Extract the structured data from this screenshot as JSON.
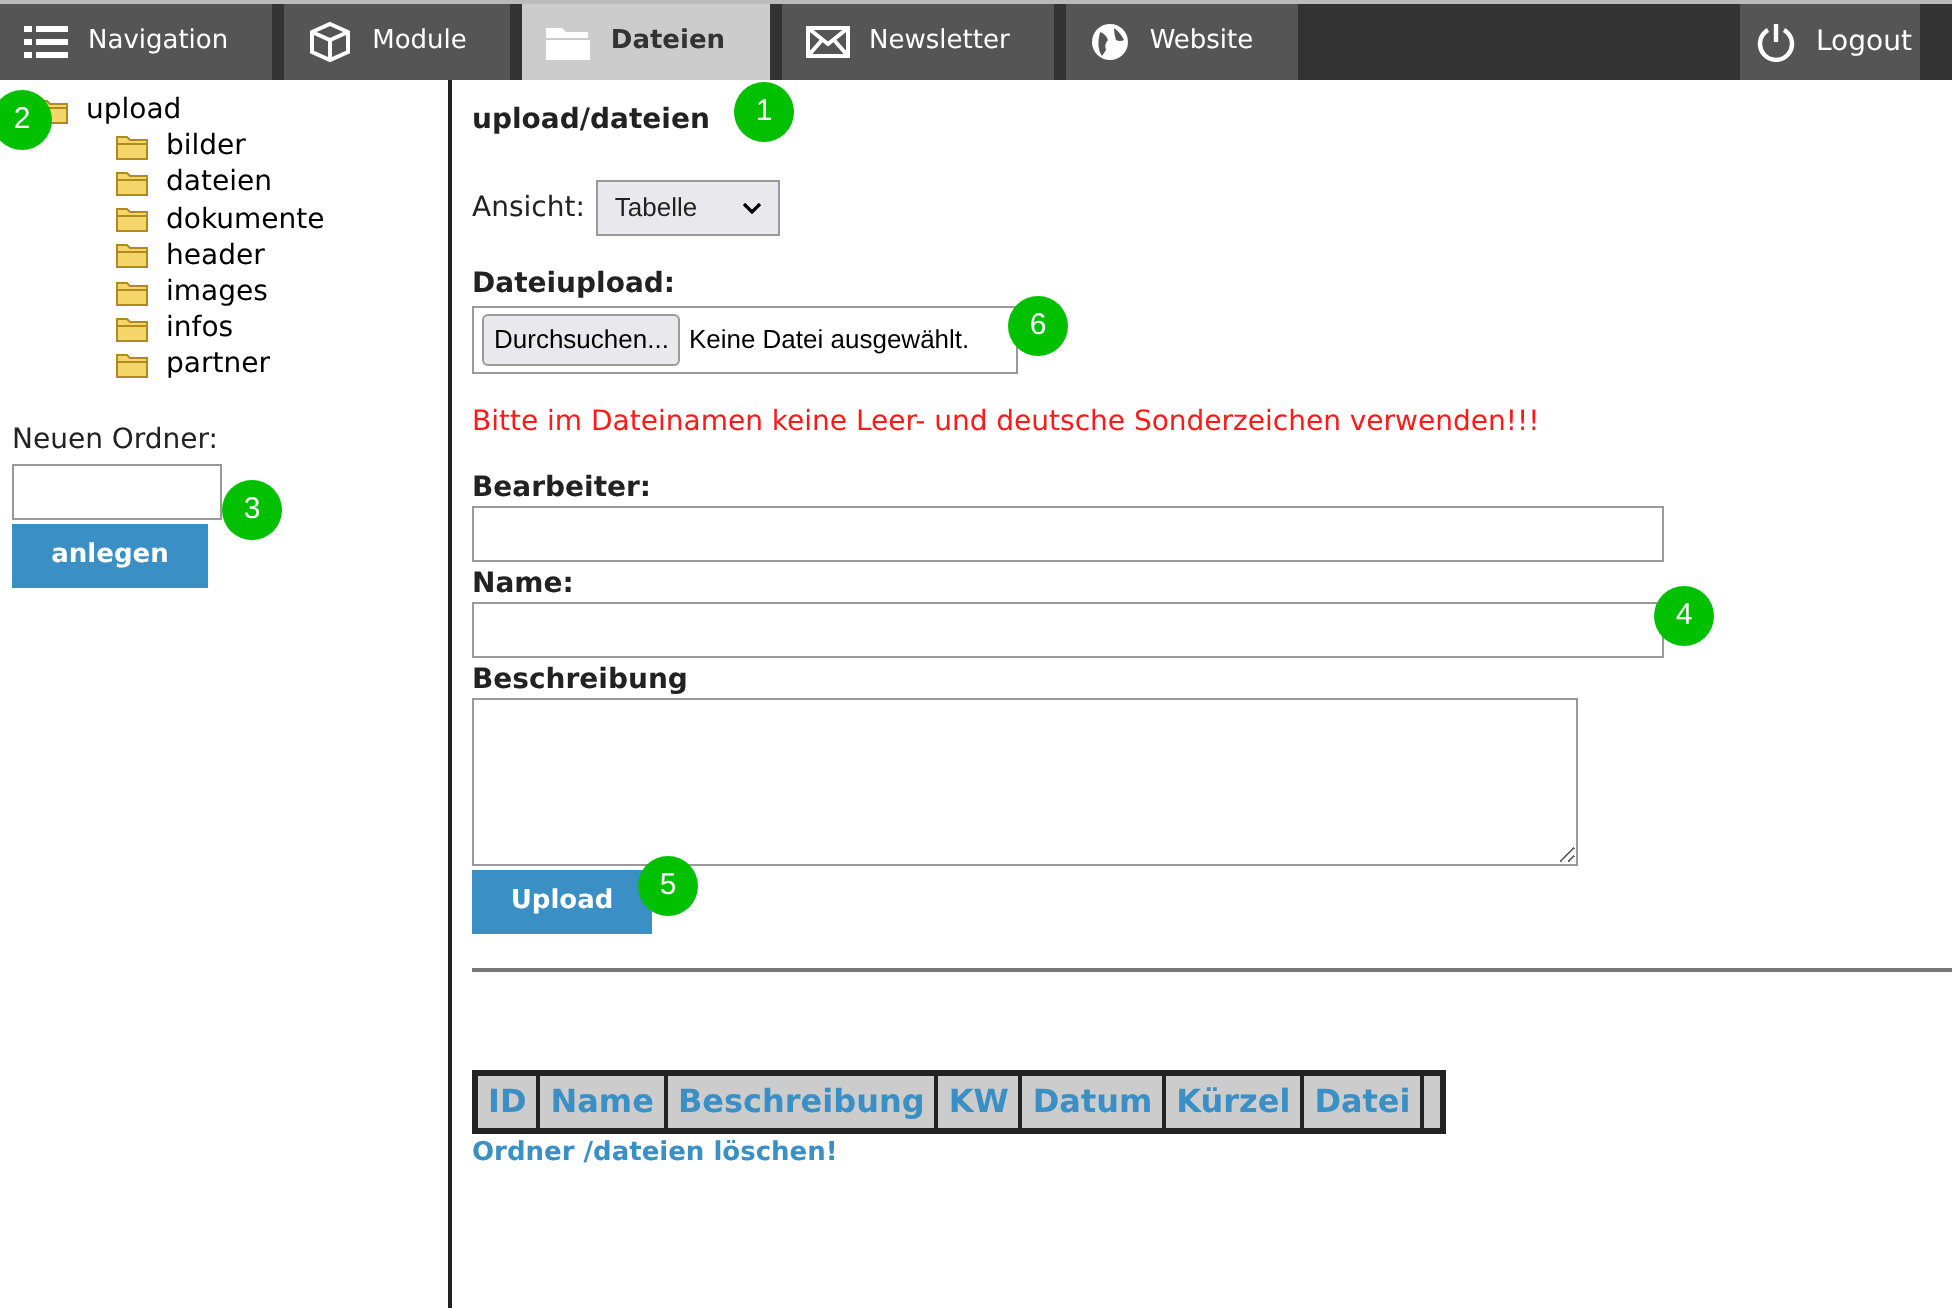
{
  "tabs": [
    {
      "label": "Navigation",
      "selected": false
    },
    {
      "label": "Module",
      "selected": false
    },
    {
      "label": "Dateien",
      "selected": true
    },
    {
      "label": "Newsletter",
      "selected": false
    },
    {
      "label": "Website",
      "selected": false
    }
  ],
  "logout": {
    "label": "Logout"
  },
  "folder_tree": [
    {
      "label": "upload",
      "children": [
        {
          "label": "bilder"
        },
        {
          "label": "dateien"
        },
        {
          "label": "dokumente"
        },
        {
          "label": "header"
        },
        {
          "label": "images"
        },
        {
          "label": "infos"
        },
        {
          "label": "partner"
        }
      ]
    }
  ],
  "new_folder": {
    "label": "Neuen Ordner:",
    "button": "anlegen"
  },
  "path": "upload/dateien",
  "view": {
    "label": "Ansicht:",
    "value": "Tabelle"
  },
  "upload": {
    "label": "Dateiupload:",
    "browse": "Durchsuchen...",
    "status": "Keine Datei ausgewählt."
  },
  "warning": "Bitte im Dateinamen keine Leer- und deutsche Sonderzeichen verwenden!!!",
  "fields": [
    {
      "label": "Bearbeiter:",
      "kind": "input"
    },
    {
      "label": "Name:",
      "kind": "input"
    },
    {
      "label": "Beschreibung",
      "kind": "textarea"
    }
  ],
  "submit": "Upload",
  "table": {
    "columns": [
      "ID",
      "Name",
      "Beschreibung",
      "KW",
      "Datum",
      "Kürzel",
      "Datei"
    ]
  },
  "delete_link": "Ordner /dateien löschen!",
  "callouts": [
    "1",
    "2",
    "3",
    "4",
    "5",
    "6"
  ]
}
